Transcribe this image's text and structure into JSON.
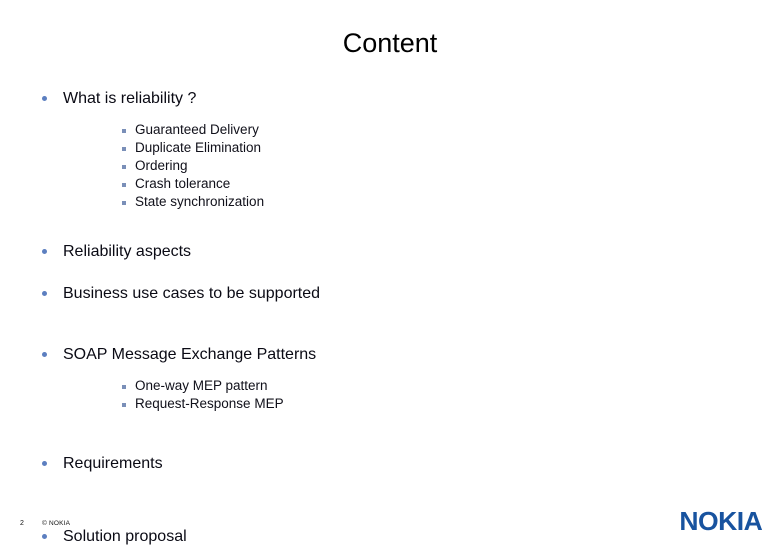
{
  "slide": {
    "title": "Content",
    "background_color": "#ffffff",
    "title_color": "#000000"
  },
  "colors": {
    "bullet_level1": "#5c7fc0",
    "bullet_level2": "#7a8fb8",
    "text_level1": "#0a0a14",
    "text_level2": "#10101a",
    "logo_blue": "#18539f"
  },
  "content": {
    "blocks": [
      {
        "heading": "What is reliability ?",
        "sub_items": [
          "Guaranteed Delivery",
          "Duplicate Elimination",
          "Ordering",
          "Crash tolerance",
          "State synchronization"
        ]
      },
      {
        "heading": "Reliability aspects",
        "sub_items": []
      },
      {
        "heading": "Business use cases to be supported",
        "sub_items": []
      },
      {
        "heading": "SOAP Message Exchange Patterns",
        "sub_items": [
          "One-way MEP pattern",
          "Request-Response MEP"
        ]
      },
      {
        "heading": "Requirements",
        "sub_items": []
      },
      {
        "heading": "Solution proposal",
        "sub_items": []
      }
    ]
  },
  "footer": {
    "page_number": "2",
    "copyright": "© NOKIA",
    "logo_text": "NOKIA"
  }
}
